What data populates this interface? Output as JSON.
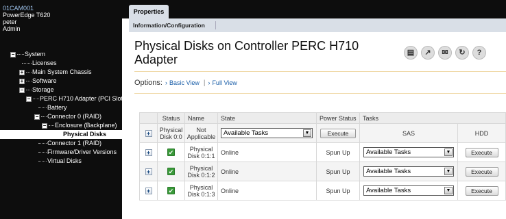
{
  "server": {
    "hostname": "01CAM001",
    "model": "PowerEdge T620",
    "user": "peter",
    "role": "Admin"
  },
  "tree": {
    "system": "System",
    "licenses": "Licenses",
    "main_chassis": "Main System Chassis",
    "software": "Software",
    "storage": "Storage",
    "controller": "PERC H710 Adapter (PCI Slot",
    "battery": "Battery",
    "connector0": "Connector 0 (RAID)",
    "enclosure": "Enclosure (Backplane)",
    "physical_disks": "Physical Disks",
    "connector1": "Connector 1 (RAID)",
    "firmware": "Firmware/Driver Versions",
    "virtual_disks": "Virtual Disks"
  },
  "tabs": {
    "properties": "Properties",
    "info_config": "Information/Configuration"
  },
  "page": {
    "title": "Physical Disks on Controller PERC H710 Adapter"
  },
  "toolbar": {
    "print": "print-icon",
    "export": "export-icon",
    "email": "email-icon",
    "refresh": "refresh-icon",
    "help": "help-icon"
  },
  "options": {
    "label": "Options:",
    "basic_view": "Basic View",
    "full_view": "Full View"
  },
  "table": {
    "headers": {
      "status": "Status",
      "name": "Name",
      "state": "State",
      "power_status": "Power Status",
      "tasks": "Tasks"
    },
    "rows": [
      {
        "status_line1": "Physical",
        "status_line2": "Disk 0:0",
        "name_line1": "Not",
        "name_line2": "Applicable",
        "state_select": "Available Tasks",
        "power_button": "Execute",
        "sas": "SAS",
        "hdd": "HDD"
      },
      {
        "status": "ok",
        "name_line1": "Physical",
        "name_line2": "Disk 0:1:1",
        "state": "Online",
        "power_status": "Spun Up",
        "tasks_select": "Available Tasks",
        "execute": "Execute"
      },
      {
        "status": "ok",
        "name_line1": "Physical",
        "name_line2": "Disk 0:1:2",
        "state": "Online",
        "power_status": "Spun Up",
        "tasks_select": "Available Tasks",
        "execute": "Execute"
      },
      {
        "status": "ok",
        "name_line1": "Physical",
        "name_line2": "Disk 0:1:3",
        "state": "Online",
        "power_status": "Spun Up",
        "tasks_select": "Available Tasks",
        "execute": "Execute"
      }
    ]
  },
  "colors": {
    "sidebar_bg": "#0d0d0d",
    "tab_bg": "#d9dfe7",
    "link": "#1a5ea8",
    "ok_green": "#3a9a3a"
  }
}
